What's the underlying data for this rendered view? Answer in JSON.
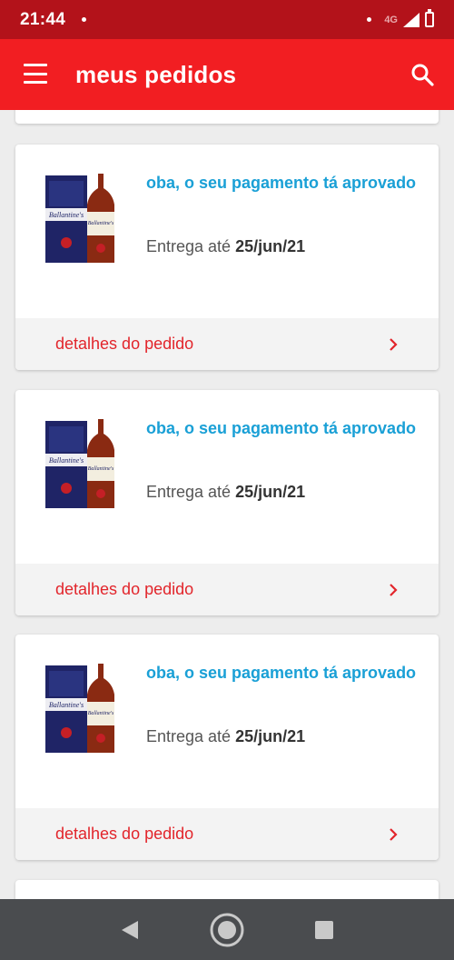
{
  "status_bar": {
    "time": "21:44",
    "network": "4G"
  },
  "app_bar": {
    "title": "meus pedidos"
  },
  "orders": [
    {
      "status": "oba, o seu pagamento tá aprovado",
      "delivery_label": "Entrega até",
      "delivery_date": "25/jun/21",
      "details_label": "detalhes do pedido"
    },
    {
      "status": "oba, o seu pagamento tá aprovado",
      "delivery_label": "Entrega até",
      "delivery_date": "25/jun/21",
      "details_label": "detalhes do pedido"
    },
    {
      "status": "oba, o seu pagamento tá aprovado",
      "delivery_label": "Entrega até",
      "delivery_date": "25/jun/21",
      "details_label": "detalhes do pedido"
    }
  ],
  "colors": {
    "status_bar": "#b3121a",
    "app_bar": "#f21e22",
    "status_text": "#1aa0d6",
    "details_text": "#e2252b",
    "nav_bar": "#4a4c4f"
  },
  "icons": {
    "menu": "menu-icon",
    "search": "search-icon",
    "chevron": "chevron-right-icon",
    "back": "back-icon",
    "home": "home-icon",
    "recents": "recents-icon"
  }
}
